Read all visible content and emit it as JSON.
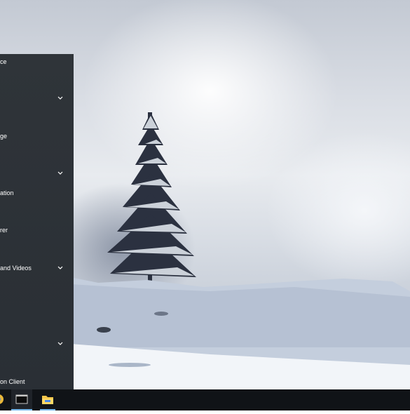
{
  "start_menu": {
    "items": [
      {
        "label": "ce",
        "expandable": false
      },
      {
        "label": "",
        "expandable": true
      },
      {
        "label": "ge",
        "expandable": false
      },
      {
        "label": "",
        "expandable": true
      },
      {
        "label": "ation",
        "expandable": false
      },
      {
        "label": "rer",
        "expandable": false
      },
      {
        "label": "and Videos",
        "expandable": true
      },
      {
        "label": "",
        "expandable": true
      },
      {
        "label": "on Client",
        "expandable": false
      }
    ]
  },
  "taskbar": {
    "icons": [
      "chrome-icon",
      "terminal-icon",
      "file-explorer-icon"
    ]
  },
  "colors": {
    "menu_bg": "#2e3338",
    "taskbar_bg": "#101317",
    "active_underline": "#76b9ed"
  }
}
